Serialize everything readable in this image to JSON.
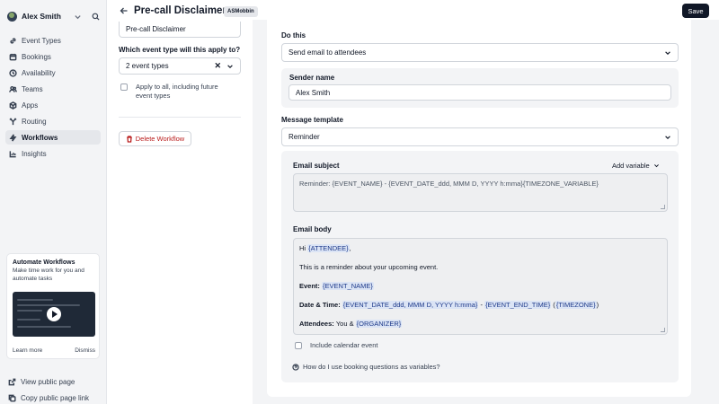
{
  "user": {
    "name": "Alex Smith"
  },
  "nav": [
    {
      "label": "Event Types",
      "icon": "link-icon"
    },
    {
      "label": "Bookings",
      "icon": "calendar-icon"
    },
    {
      "label": "Availability",
      "icon": "clock-icon"
    },
    {
      "label": "Teams",
      "icon": "users-icon"
    },
    {
      "label": "Apps",
      "icon": "grid-icon"
    },
    {
      "label": "Routing",
      "icon": "routing-icon"
    },
    {
      "label": "Workflows",
      "icon": "zap-icon",
      "active": true
    },
    {
      "label": "Insights",
      "icon": "chart-icon"
    }
  ],
  "promo": {
    "title": "Automate Workflows",
    "description": "Make time work for you and automate tasks",
    "learn_more": "Learn more",
    "dismiss": "Dismiss"
  },
  "public_links": {
    "view": "View public page",
    "copy": "Copy public page link"
  },
  "header": {
    "title": "Pre-call Disclaimer",
    "badge": "ASMobbin",
    "save": "Save"
  },
  "left": {
    "name_value": "Pre-call Disclaimer",
    "event_type_label": "Which event type will this apply to?",
    "event_type_value": "2 event types",
    "apply_all": "Apply to all, including future event types",
    "delete": "Delete Workflow"
  },
  "action": {
    "do_this_label": "Do this",
    "do_this_value": "Send email to attendees",
    "sender_label": "Sender name",
    "sender_value": "Alex Smith",
    "template_label": "Message template",
    "template_value": "Reminder",
    "subject_label": "Email subject",
    "add_variable": "Add variable",
    "subject_value": "Reminder: {EVENT_NAME} - {EVENT_DATE_ddd, MMM D, YYYY h:mma}{TIMEZONE_VARIABLE}",
    "body_label": "Email body",
    "body": {
      "greet_hi": "Hi ",
      "greet_var": "{ATTENDEE}",
      "greet_end": ",",
      "intro": "This is a reminder about your upcoming event.",
      "event_label": "Event: ",
      "event_var": "{EVENT_NAME}",
      "dt_label": "Date & Time: ",
      "dt_var1": "{EVENT_DATE_ddd, MMM D, YYYY h:mma}",
      "dt_sep": " - ",
      "dt_var2": "{EVENT_END_TIME}",
      "dt_open": " (",
      "dt_var3": "{TIMEZONE}",
      "dt_close": ")",
      "att_label": "Attendees: ",
      "att_you": "You & ",
      "att_var": "{ORGANIZER}"
    },
    "include_calendar": "Include calendar event",
    "help": "How do I use booking questions as variables?"
  }
}
